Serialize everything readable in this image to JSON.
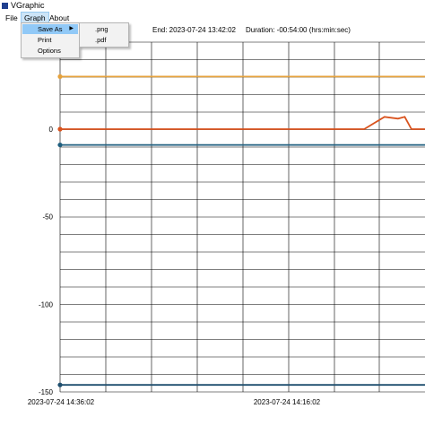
{
  "window": {
    "title": "VGraphic"
  },
  "menubar": {
    "items": [
      "File",
      "Graph",
      "About"
    ]
  },
  "graph_menu": {
    "items": [
      {
        "label": "Save As",
        "has_submenu": true
      },
      {
        "label": "Print"
      },
      {
        "label": "Options"
      }
    ],
    "save_as_submenu": [
      ".png",
      ".pdf"
    ]
  },
  "header": {
    "end": "End: 2023-07-24 13:42:02",
    "duration": "Duration: -00:54:00 (hrs:min:sec)"
  },
  "colors": {
    "orange": "#e6a23c",
    "red": "#d9531e",
    "teal": "#1f5f7f",
    "dark_blue": "#1f4f6f"
  },
  "chart_data": {
    "type": "line",
    "ylim": [
      -150,
      10
    ],
    "yticks": [
      0,
      -50,
      -100,
      -150
    ],
    "xtick_labels": [
      "2023-07-24 14:36:02",
      "2023-07-24 14:16:02"
    ],
    "x": [
      0,
      3,
      6,
      9,
      12,
      15,
      18,
      21,
      24,
      27,
      30,
      33,
      36,
      39,
      42,
      45,
      48,
      50,
      51,
      52,
      54
    ],
    "series": [
      {
        "color": "#e6a23c",
        "values": [
          30,
          30,
          30,
          30,
          30,
          30,
          30,
          30,
          30,
          30,
          30,
          30,
          30,
          30,
          30,
          30,
          30,
          30,
          30,
          30,
          30
        ]
      },
      {
        "color": "#d9531e",
        "values": [
          0,
          0,
          0,
          0,
          0,
          0,
          0,
          0,
          0,
          0,
          0,
          0,
          0,
          0,
          0,
          0,
          7,
          6,
          7,
          0,
          0
        ]
      },
      {
        "color": "#1f5f7f",
        "values": [
          -9,
          -9,
          -9,
          -9,
          -9,
          -9,
          -9,
          -9,
          -9,
          -9,
          -9,
          -9,
          -9,
          -9,
          -9,
          -9,
          -9,
          -9,
          -9,
          -9,
          -9
        ]
      },
      {
        "color": "#1f4f6f",
        "values": [
          -146,
          -146,
          -146,
          -146,
          -146,
          -146,
          -146,
          -146,
          -146,
          -146,
          -146,
          -146,
          -146,
          -146,
          -146,
          -146,
          -146,
          -146,
          -146,
          -146,
          -146
        ]
      }
    ]
  }
}
